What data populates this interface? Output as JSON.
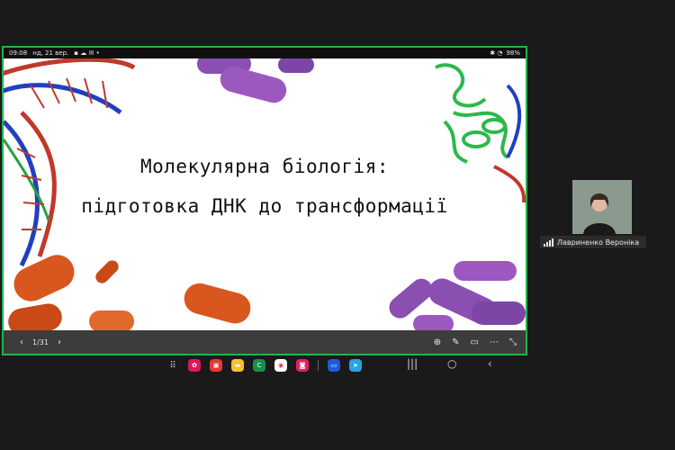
{
  "statusbar": {
    "time": "09:08",
    "date": "нд, 21 вер.",
    "battery": "98%"
  },
  "slide": {
    "title_line1": "Молекулярна біологія:",
    "title_line2": "підготовка ДНК до трансформації"
  },
  "controls": {
    "page": "1/31",
    "prev": "‹",
    "next": "›"
  },
  "participant": {
    "name": "Лавриненко Вероніка"
  },
  "taskbar": {
    "apps": [
      "grid-icon",
      "app-flower",
      "app-red",
      "app-notes",
      "app-green-c",
      "app-chrome",
      "app-screen",
      "app-samsung",
      "app-telegram"
    ]
  },
  "colors": {
    "share_border": "#23b34a",
    "background": "#1a1a1a"
  }
}
